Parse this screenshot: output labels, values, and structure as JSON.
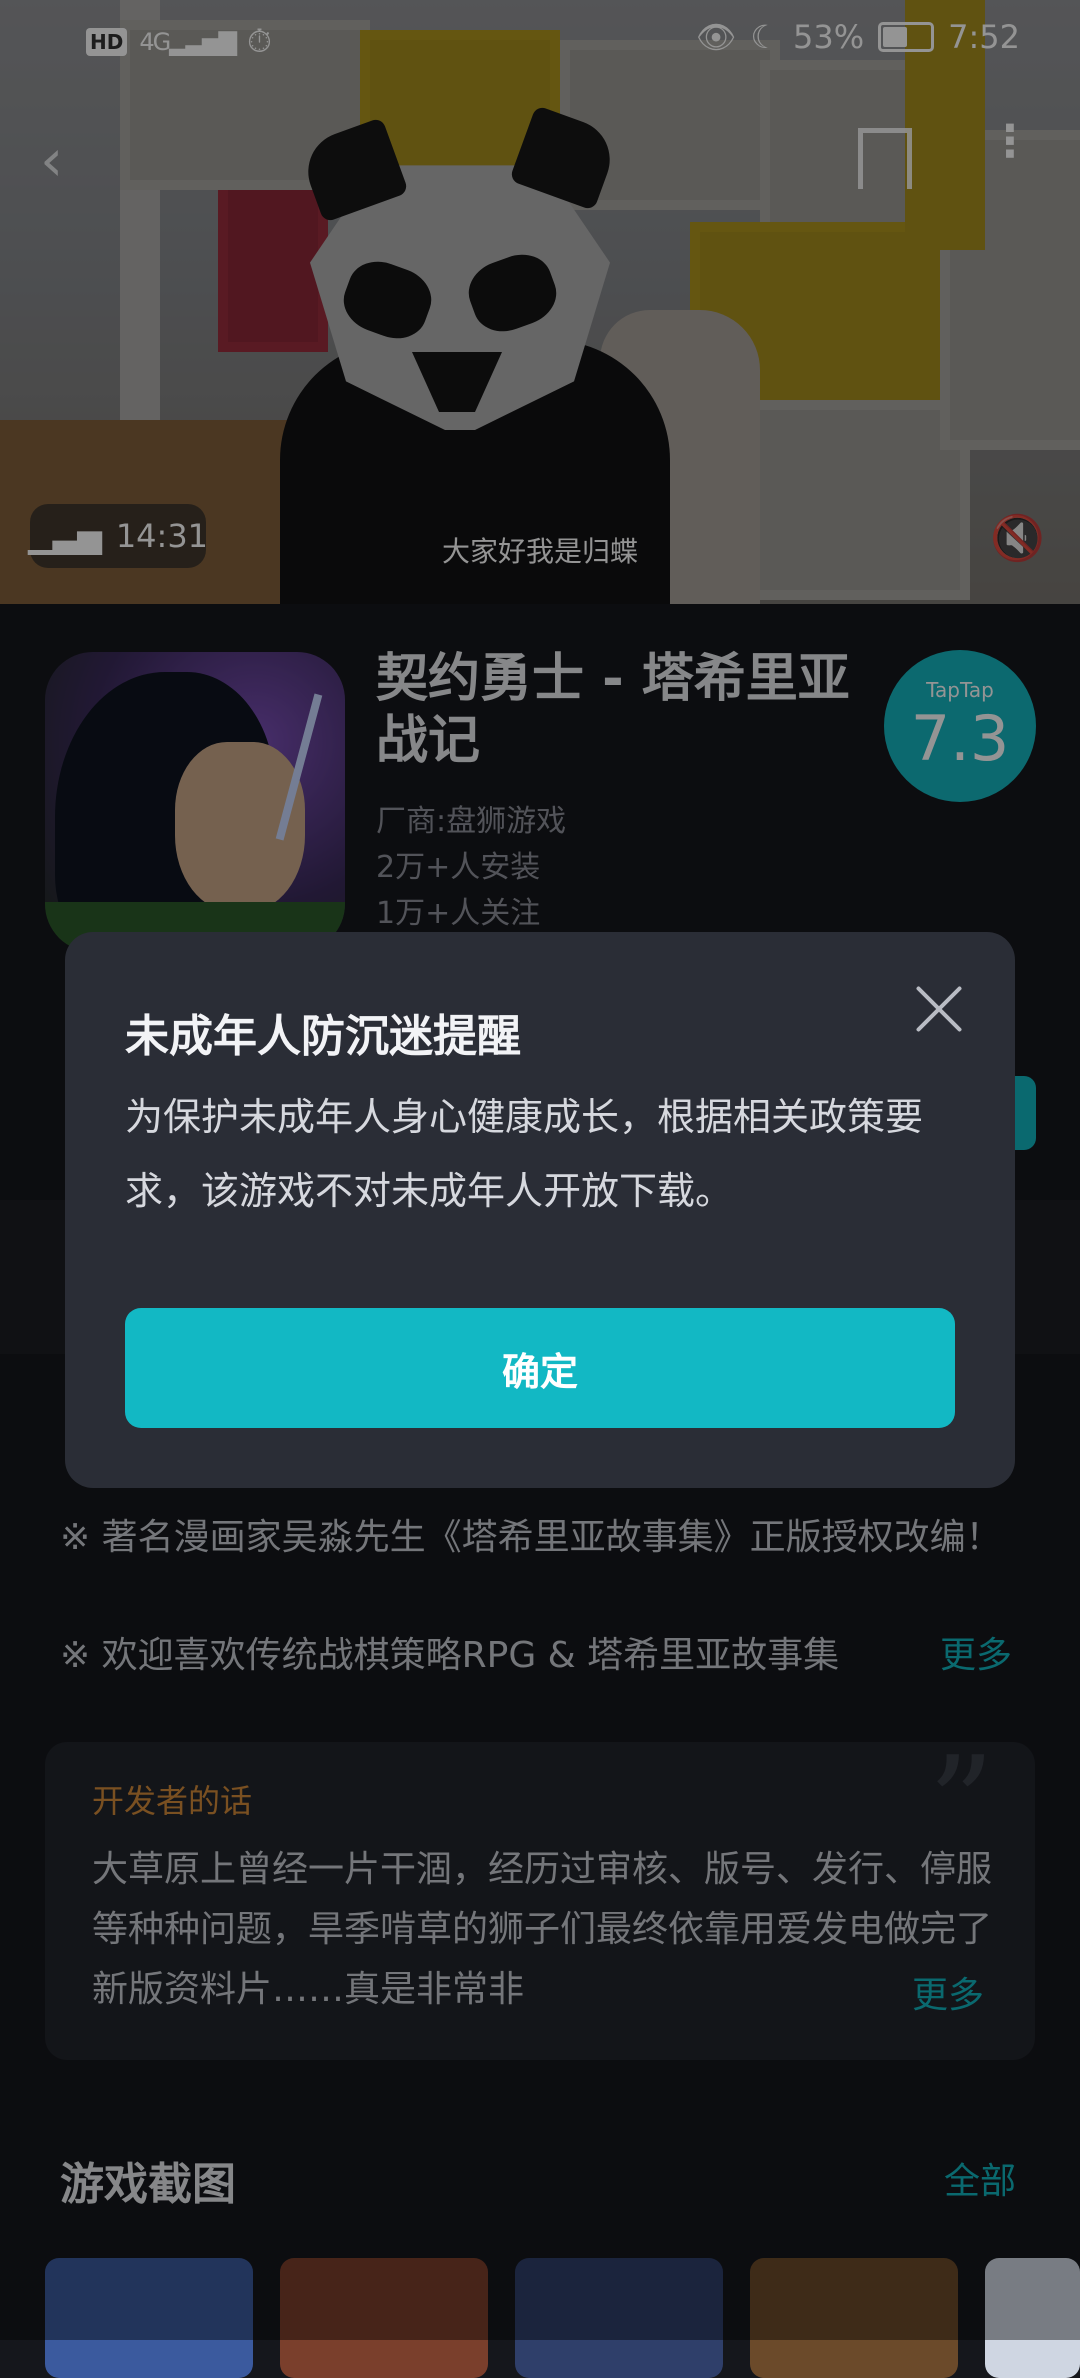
{
  "status_bar": {
    "network_badge": "HD",
    "network_type": "4G",
    "battery_percent": "53%",
    "time": "7:52"
  },
  "video": {
    "duration": "14:31",
    "subtitle": "大家好我是归蝶"
  },
  "app": {
    "title": "契约勇士 - 塔希里亚战记",
    "vendor": "厂商:盘狮游戏",
    "installs": "2万+人安装",
    "followers": "1万+人关注",
    "score_label": "TapTap",
    "score": "7.3"
  },
  "description": {
    "line1": "※ 著名漫画家吴淼先生《塔希里亚故事集》正版授权改编！",
    "line2": "※ 欢迎喜欢传统战棋策略RPG & 塔希里亚故事集",
    "more": "更多"
  },
  "developer_note": {
    "title": "开发者的话",
    "text": "大草原上曾经一片干涸，经历过审核、版号、发行、停服等种种问题，旱季啃草的狮子们最终依靠用爱发电做完了新版资料片……真是非常非",
    "more": "更多"
  },
  "screenshots": {
    "title": "游戏截图",
    "all": "全部"
  },
  "dialog": {
    "title": "未成年人防沉迷提醒",
    "body": "为保护未成年人身心健康成长，根据相关政策要求，该游戏不对未成年人开放下载。",
    "confirm": "确定"
  },
  "colors": {
    "accent": "#12b8c4",
    "developer_title": "#d38a3a"
  },
  "icons": [
    "back-icon",
    "bookmark-icon",
    "more-icon",
    "audio-wave-icon",
    "mute-icon",
    "close-icon",
    "eye-icon",
    "moon-icon",
    "alarm-icon"
  ]
}
